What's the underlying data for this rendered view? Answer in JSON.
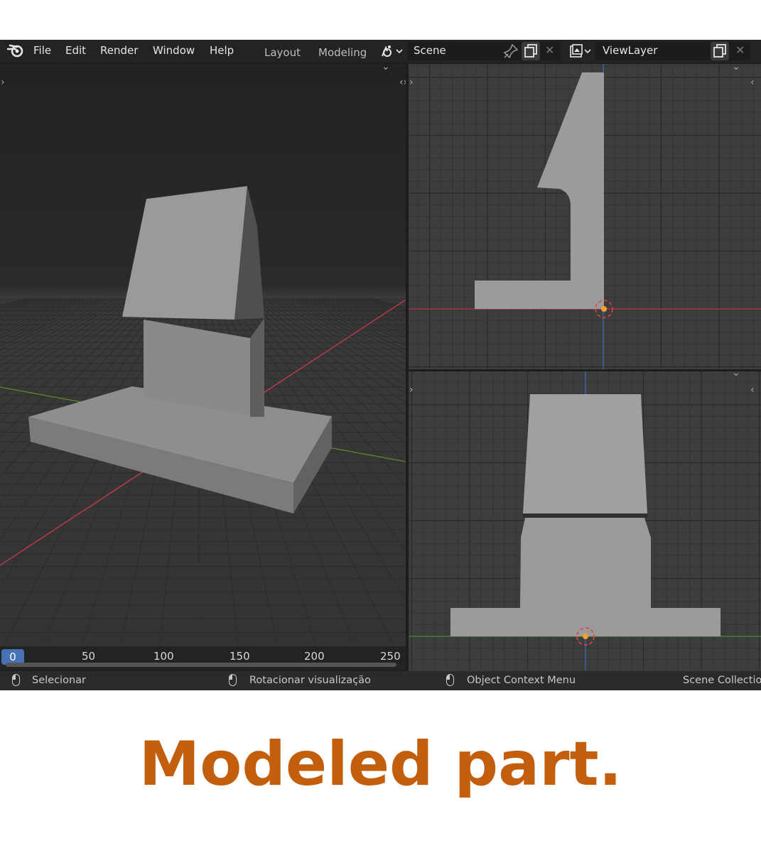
{
  "menu": {
    "items": [
      "File",
      "Edit",
      "Render",
      "Window",
      "Help"
    ],
    "workspaces": [
      "Layout",
      "Modeling"
    ]
  },
  "scene": {
    "label": "Scene"
  },
  "view_layer": {
    "label": "ViewLayer"
  },
  "timeline": {
    "current_frame": "0",
    "ticks": [
      "50",
      "100",
      "150",
      "200",
      "250"
    ]
  },
  "status_bar": {
    "select": "Selecionar",
    "rotate": "Rotacionar visualização",
    "context": "Object Context Menu",
    "collection": "Scene Collection"
  },
  "caption": "Modeled part.",
  "colors": {
    "caption": "#c35f0c",
    "x_axis": "#c43a4b",
    "y_axis": "#6d9a2e",
    "z_axis": "#3a6fb5",
    "origin": "#f4a12b"
  },
  "icons": [
    "blender-logo-icon",
    "scene-icon",
    "pin-icon",
    "new-scene-icon",
    "close-icon",
    "view-layer-icon",
    "mouse-left-icon",
    "mouse-middle-icon",
    "mouse-right-icon"
  ]
}
